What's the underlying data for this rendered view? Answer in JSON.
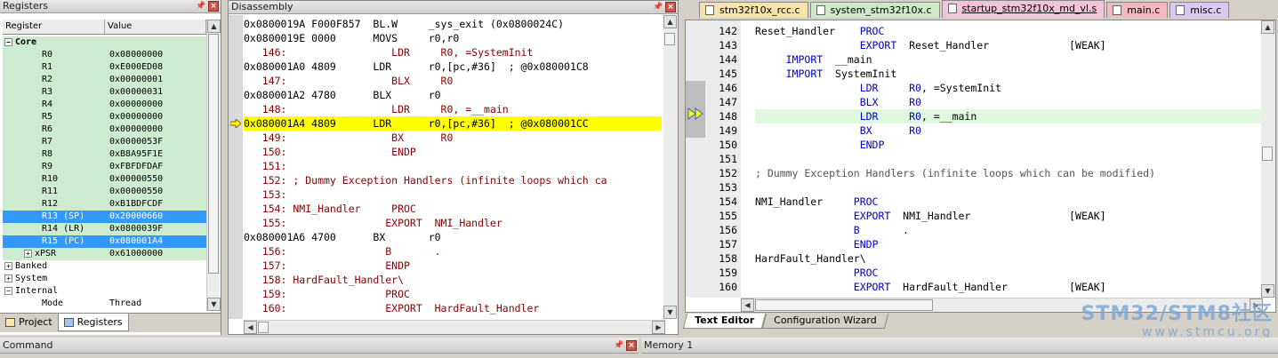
{
  "registers": {
    "title": "Registers",
    "columns": [
      "Register",
      "Value"
    ],
    "groups": {
      "core": "Core",
      "banked": "Banked",
      "system": "System",
      "internal": "Internal"
    },
    "core_rows": [
      {
        "name": "R0",
        "value": "0x08000000"
      },
      {
        "name": "R1",
        "value": "0xE000ED08"
      },
      {
        "name": "R2",
        "value": "0x00000001"
      },
      {
        "name": "R3",
        "value": "0x00000031"
      },
      {
        "name": "R4",
        "value": "0x00000000"
      },
      {
        "name": "R5",
        "value": "0x00000000"
      },
      {
        "name": "R6",
        "value": "0x00000000"
      },
      {
        "name": "R7",
        "value": "0x0000053F"
      },
      {
        "name": "R8",
        "value": "0xB8A95F1E"
      },
      {
        "name": "R9",
        "value": "0xFBFDFDAF"
      },
      {
        "name": "R10",
        "value": "0x00000550"
      },
      {
        "name": "R11",
        "value": "0x00000550"
      },
      {
        "name": "R12",
        "value": "0xB1BDFCDF"
      },
      {
        "name": "R13 (SP)",
        "value": "0x20000660"
      },
      {
        "name": "R14 (LR)",
        "value": "0x0800039F"
      },
      {
        "name": "R15 (PC)",
        "value": "0x080001A4"
      },
      {
        "name": "xPSR",
        "value": "0x61000000"
      }
    ],
    "mode": {
      "name": "Mode",
      "value": "Thread"
    },
    "tabs": {
      "project": "Project",
      "registers": "Registers"
    }
  },
  "disassembly": {
    "title": "Disassembly",
    "lines": [
      {
        "text": "0x0800019A F000F857  BL.W     _sys_exit (0x0800024C)",
        "kind": "asm"
      },
      {
        "text": "0x0800019E 0000      MOVS     r0,r0",
        "kind": "asm"
      },
      {
        "text": "   146:                 LDR     R0, =SystemInit",
        "kind": "src"
      },
      {
        "text": "0x080001A0 4809      LDR      r0,[pc,#36]  ; @0x080001C8",
        "kind": "asm"
      },
      {
        "text": "   147:                 BLX     R0",
        "kind": "src"
      },
      {
        "text": "0x080001A2 4780      BLX      r0",
        "kind": "asm"
      },
      {
        "text": "   148:                 LDR     R0, =__main",
        "kind": "src"
      },
      {
        "text": "0x080001A4 4809      LDR      r0,[pc,#36]  ; @0x080001CC",
        "kind": "cur"
      },
      {
        "text": "   149:                 BX      R0",
        "kind": "src"
      },
      {
        "text": "   150:                 ENDP",
        "kind": "src"
      },
      {
        "text": "   151: ",
        "kind": "src"
      },
      {
        "text": "   152: ; Dummy Exception Handlers (infinite loops which ca",
        "kind": "src"
      },
      {
        "text": "   153: ",
        "kind": "src"
      },
      {
        "text": "   154: NMI_Handler     PROC",
        "kind": "src"
      },
      {
        "text": "   155:                EXPORT  NMI_Handler",
        "kind": "src"
      },
      {
        "text": "0x080001A6 4700      BX       r0",
        "kind": "asm"
      },
      {
        "text": "   156:                B       .",
        "kind": "src"
      },
      {
        "text": "   157:                ENDP",
        "kind": "src"
      },
      {
        "text": "   158: HardFault_Handler\\",
        "kind": "src"
      },
      {
        "text": "   159:                PROC",
        "kind": "src"
      },
      {
        "text": "   160:                EXPORT  HardFault_Handler",
        "kind": "src"
      }
    ]
  },
  "editor": {
    "file_tabs": [
      {
        "label": "stm32f10x_rcc.c",
        "color": "#f3e4a8",
        "active": false
      },
      {
        "label": "system_stm32f10x.c",
        "color": "#cfe8c8",
        "active": false
      },
      {
        "label": "startup_stm32f10x_md_vl.s",
        "color": "#f2c4d9",
        "active": true
      },
      {
        "label": "main.c",
        "color": "#f4b8c0",
        "active": false
      },
      {
        "label": "misc.c",
        "color": "#d9c8f0",
        "active": false
      }
    ],
    "line_numbers": [
      "142",
      "143",
      "144",
      "145",
      "146",
      "147",
      "148",
      "149",
      "150",
      "151",
      "152",
      "153",
      "154",
      "155",
      "156",
      "157",
      "158",
      "159",
      "160"
    ],
    "bottom_tabs": {
      "text_editor": "Text Editor",
      "config_wizard": "Configuration Wizard"
    }
  },
  "command": {
    "title": "Command"
  },
  "memory": {
    "title": "Memory 1"
  },
  "watermark": {
    "line1": "STM32/STM8社区",
    "line2": "www.stmcu.org"
  }
}
